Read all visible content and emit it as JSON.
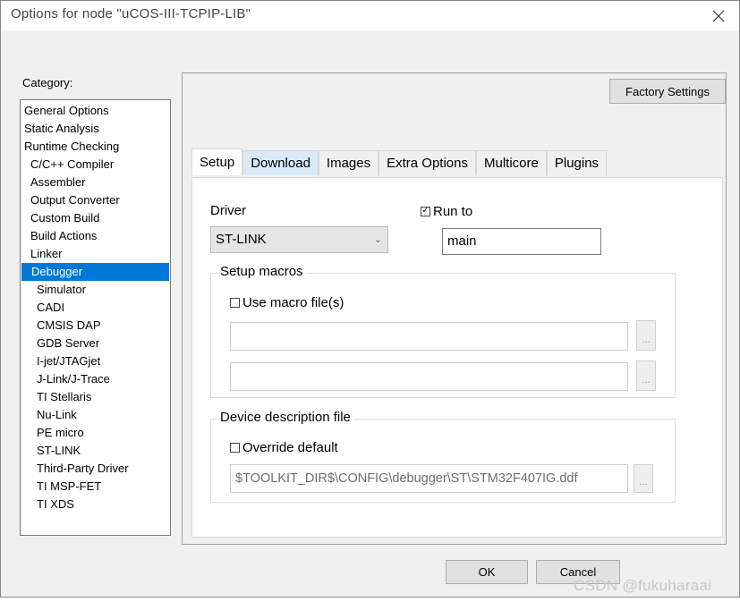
{
  "window": {
    "title": "Options for node \"uCOS-III-TCPIP-LIB\""
  },
  "category": {
    "label": "Category:",
    "items": [
      {
        "label": "General Options",
        "level": 0
      },
      {
        "label": "Static Analysis",
        "level": 0
      },
      {
        "label": "Runtime Checking",
        "level": 0
      },
      {
        "label": "C/C++ Compiler",
        "level": 1
      },
      {
        "label": "Assembler",
        "level": 1
      },
      {
        "label": "Output Converter",
        "level": 1
      },
      {
        "label": "Custom Build",
        "level": 1
      },
      {
        "label": "Build Actions",
        "level": 1
      },
      {
        "label": "Linker",
        "level": 1
      },
      {
        "label": "Debugger",
        "level": 1,
        "selected": true
      },
      {
        "label": "Simulator",
        "level": 2
      },
      {
        "label": "CADI",
        "level": 2
      },
      {
        "label": "CMSIS DAP",
        "level": 2
      },
      {
        "label": "GDB Server",
        "level": 2
      },
      {
        "label": "I-jet/JTAGjet",
        "level": 2
      },
      {
        "label": "J-Link/J-Trace",
        "level": 2
      },
      {
        "label": "TI Stellaris",
        "level": 2
      },
      {
        "label": "Nu-Link",
        "level": 2
      },
      {
        "label": "PE micro",
        "level": 2
      },
      {
        "label": "ST-LINK",
        "level": 2
      },
      {
        "label": "Third-Party Driver",
        "level": 2
      },
      {
        "label": "TI MSP-FET",
        "level": 2
      },
      {
        "label": "TI XDS",
        "level": 2
      }
    ]
  },
  "factory_settings_label": "Factory Settings",
  "tabs": [
    {
      "label": "Setup",
      "active": true
    },
    {
      "label": "Download",
      "hover": true
    },
    {
      "label": "Images"
    },
    {
      "label": "Extra Options"
    },
    {
      "label": "Multicore"
    },
    {
      "label": "Plugins"
    }
  ],
  "setup": {
    "driver_label": "Driver",
    "driver_value": "ST-LINK",
    "run_to_label": "Run to",
    "run_to_checked": true,
    "run_to_value": "main",
    "macros_group_title": "Setup macros",
    "use_macro_label": "Use macro file(s)",
    "use_macro_checked": false,
    "macro_file_1": "",
    "macro_file_2": "",
    "browse_label": "...",
    "device_group_title": "Device description file",
    "override_label": "Override default",
    "override_checked": false,
    "device_file_value": "$TOOLKIT_DIR$\\CONFIG\\debugger\\ST\\STM32F407IG.ddf"
  },
  "ok_label": "OK",
  "cancel_label": "Cancel",
  "watermark": "CSDN @fukuharaai",
  "colors": {
    "selection": "#0078d7",
    "tab_hover": "#d8eaf9",
    "dialog_bg": "#f0f0f0"
  }
}
